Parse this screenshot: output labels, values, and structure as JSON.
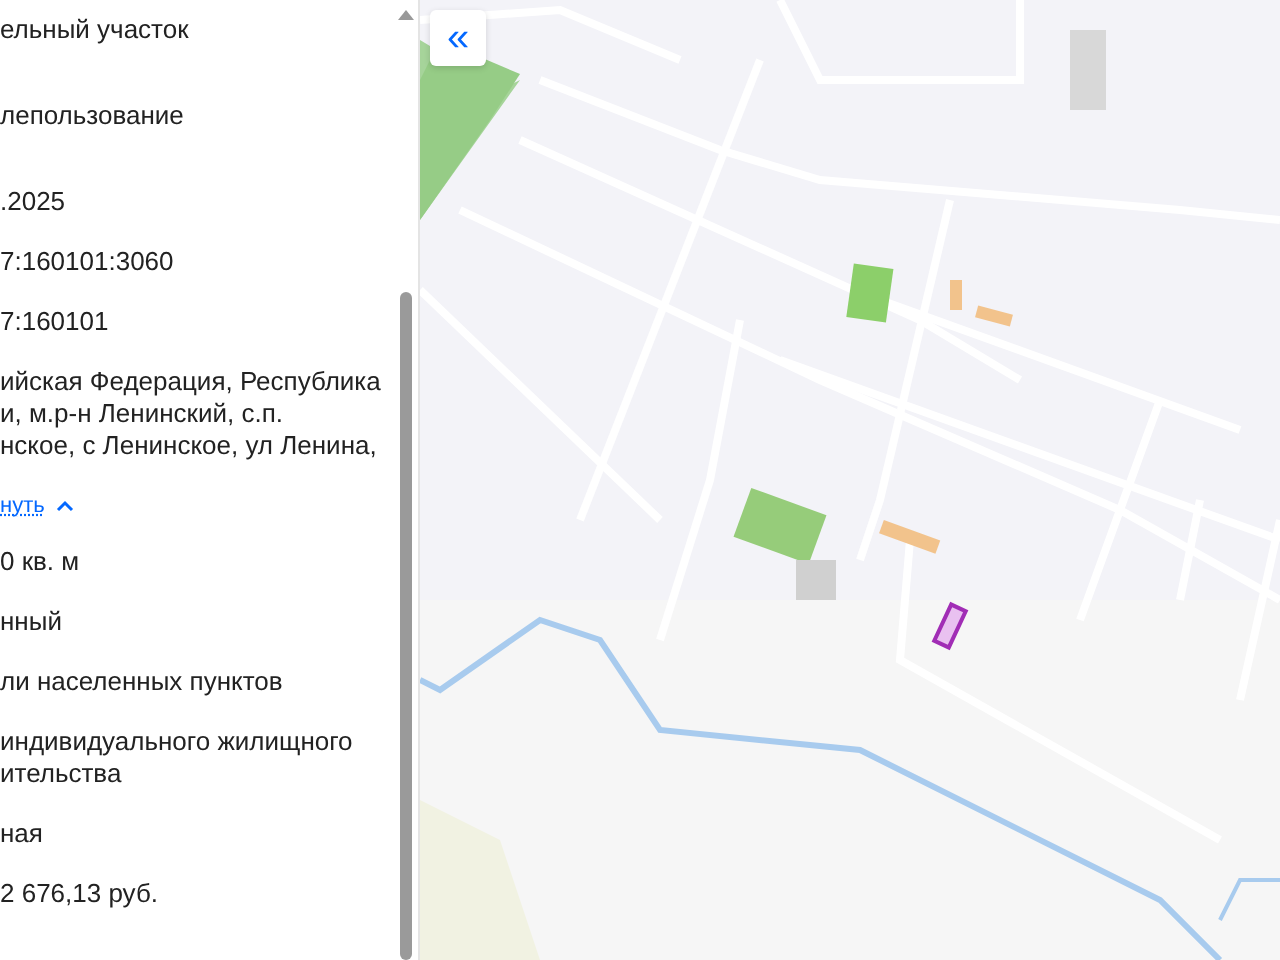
{
  "details": [
    {
      "kind": "text",
      "text": "ельный участок"
    },
    {
      "kind": "text",
      "text": "лепользование"
    },
    {
      "kind": "text",
      "text": ".2025"
    },
    {
      "kind": "text",
      "text": "7:160101:3060"
    },
    {
      "kind": "text",
      "text": "7:160101"
    },
    {
      "kind": "text",
      "text": "ийская Федерация, Республика\nи, м.р-н Ленинский, с.п.\nнское, с Ленинское, ул Ленина,"
    },
    {
      "kind": "link",
      "text": "нуть"
    },
    {
      "kind": "text",
      "text": "0 кв. м"
    },
    {
      "kind": "text",
      "text": "нный"
    },
    {
      "kind": "text",
      "text": "ли населенных пунктов"
    },
    {
      "kind": "text",
      "text": "индивидуального жилищного\nительства"
    },
    {
      "kind": "text",
      "text": "ная"
    },
    {
      "kind": "text",
      "text": "2 676,13 руб."
    }
  ],
  "map": {
    "collapse_button": "«"
  }
}
